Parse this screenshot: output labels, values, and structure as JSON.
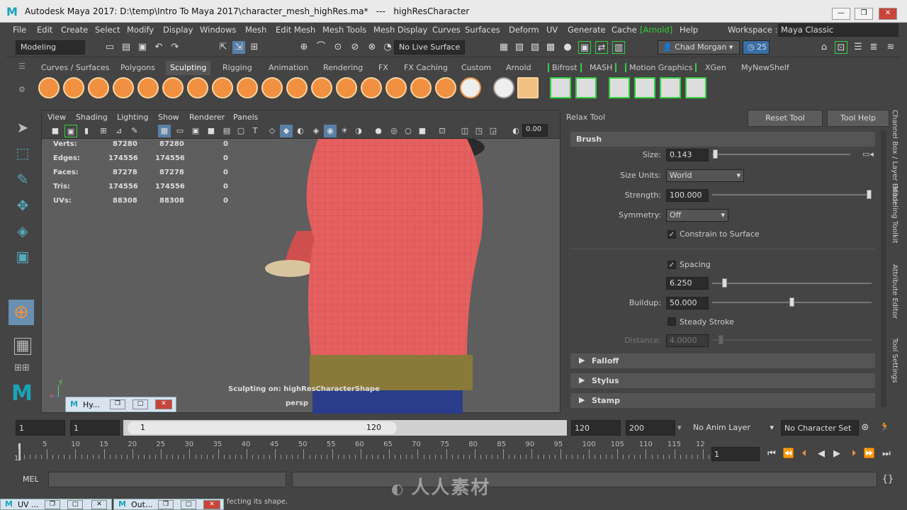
{
  "window": {
    "title": "Autodesk Maya 2017: D:\\temp\\Intro To Maya 2017\\character_mesh_highRes.ma*   ---   highResCharacter",
    "logo": "M",
    "min": "—",
    "max": "❐",
    "close": "✕"
  },
  "menu": {
    "items": [
      "File",
      "Edit",
      "Create",
      "Select",
      "Modify",
      "Display",
      "Windows",
      "Mesh",
      "Edit Mesh",
      "Mesh Tools",
      "Mesh Display",
      "Curves",
      "Surfaces",
      "Deform",
      "UV",
      "Generate",
      "Cache",
      "[Arnold]",
      "Help"
    ],
    "workspace_label": "Workspace :",
    "workspace_value": "Maya Classic"
  },
  "status": {
    "mode": "Modeling",
    "live_surface": "No Live Surface",
    "user": "Chad Morgan",
    "credits": "25"
  },
  "shelf": {
    "tabs": [
      "Curves / Surfaces",
      "Polygons",
      "Sculpting",
      "Rigging",
      "Animation",
      "Rendering",
      "FX",
      "FX Caching",
      "Custom",
      "Arnold",
      "Bifrost",
      "MASH",
      "Motion Graphics",
      "XGen",
      "MyNewShelf"
    ],
    "active": "Sculpting"
  },
  "viewport": {
    "menu": [
      "View",
      "Shading",
      "Lighting",
      "Show",
      "Renderer",
      "Panels"
    ],
    "value": "0.00",
    "hud": [
      {
        "label": "Verts:",
        "a": "87280",
        "b": "87280",
        "c": "0"
      },
      {
        "label": "Edges:",
        "a": "174556",
        "b": "174556",
        "c": "0"
      },
      {
        "label": "Faces:",
        "a": "87278",
        "b": "87278",
        "c": "0"
      },
      {
        "label": "Tris:",
        "a": "174556",
        "b": "174556",
        "c": "0"
      },
      {
        "label": "UVs:",
        "a": "88308",
        "b": "88308",
        "c": "0"
      }
    ],
    "sculpt_msg": "Sculpting on: highResCharacterShape",
    "camera": "persp",
    "axis_y": "y",
    "axis_x": "x"
  },
  "tool": {
    "name": "Relax Tool",
    "reset": "Reset Tool",
    "help": "Tool Help",
    "brush": "Brush",
    "size_label": "Size:",
    "size": "0.143",
    "units_label": "Size Units:",
    "units": "World",
    "strength_label": "Strength:",
    "strength": "100.000",
    "sym_label": "Symmetry:",
    "sym": "Off",
    "constrain": "Constrain to Surface",
    "spacing": "Spacing",
    "spacing_val": "6.250",
    "buildup_label": "Buildup:",
    "buildup": "50.000",
    "steady": "Steady Stroke",
    "distance_label": "Distance:",
    "distance": "4.0000",
    "falloff": "Falloff",
    "stylus": "Stylus",
    "stamp": "Stamp"
  },
  "sidetabs": [
    "Channel Box / Layer Editor",
    "Modeling Toolkit",
    "Attribute Editor",
    "Tool Settings"
  ],
  "range": {
    "start": "1",
    "start2": "1",
    "slider_start": "1",
    "slider_end": "120",
    "end": "120",
    "end2": "200",
    "anim_layer": "No Anim Layer",
    "char_set": "No Character Set"
  },
  "timeline": {
    "ticks": [
      "5",
      "10",
      "15",
      "20",
      "25",
      "30",
      "35",
      "40",
      "45",
      "50",
      "55",
      "60",
      "65",
      "70",
      "75",
      "80",
      "85",
      "90",
      "95",
      "100",
      "105",
      "110",
      "115",
      "12"
    ],
    "first": "1",
    "current": "1"
  },
  "cmd": {
    "label": "MEL"
  },
  "help": {
    "text": "fecting its shape."
  },
  "minimized": [
    {
      "label": "Hy..."
    },
    {
      "label": "UV ..."
    },
    {
      "label": "Out..."
    }
  ],
  "watermark": "人人素材"
}
